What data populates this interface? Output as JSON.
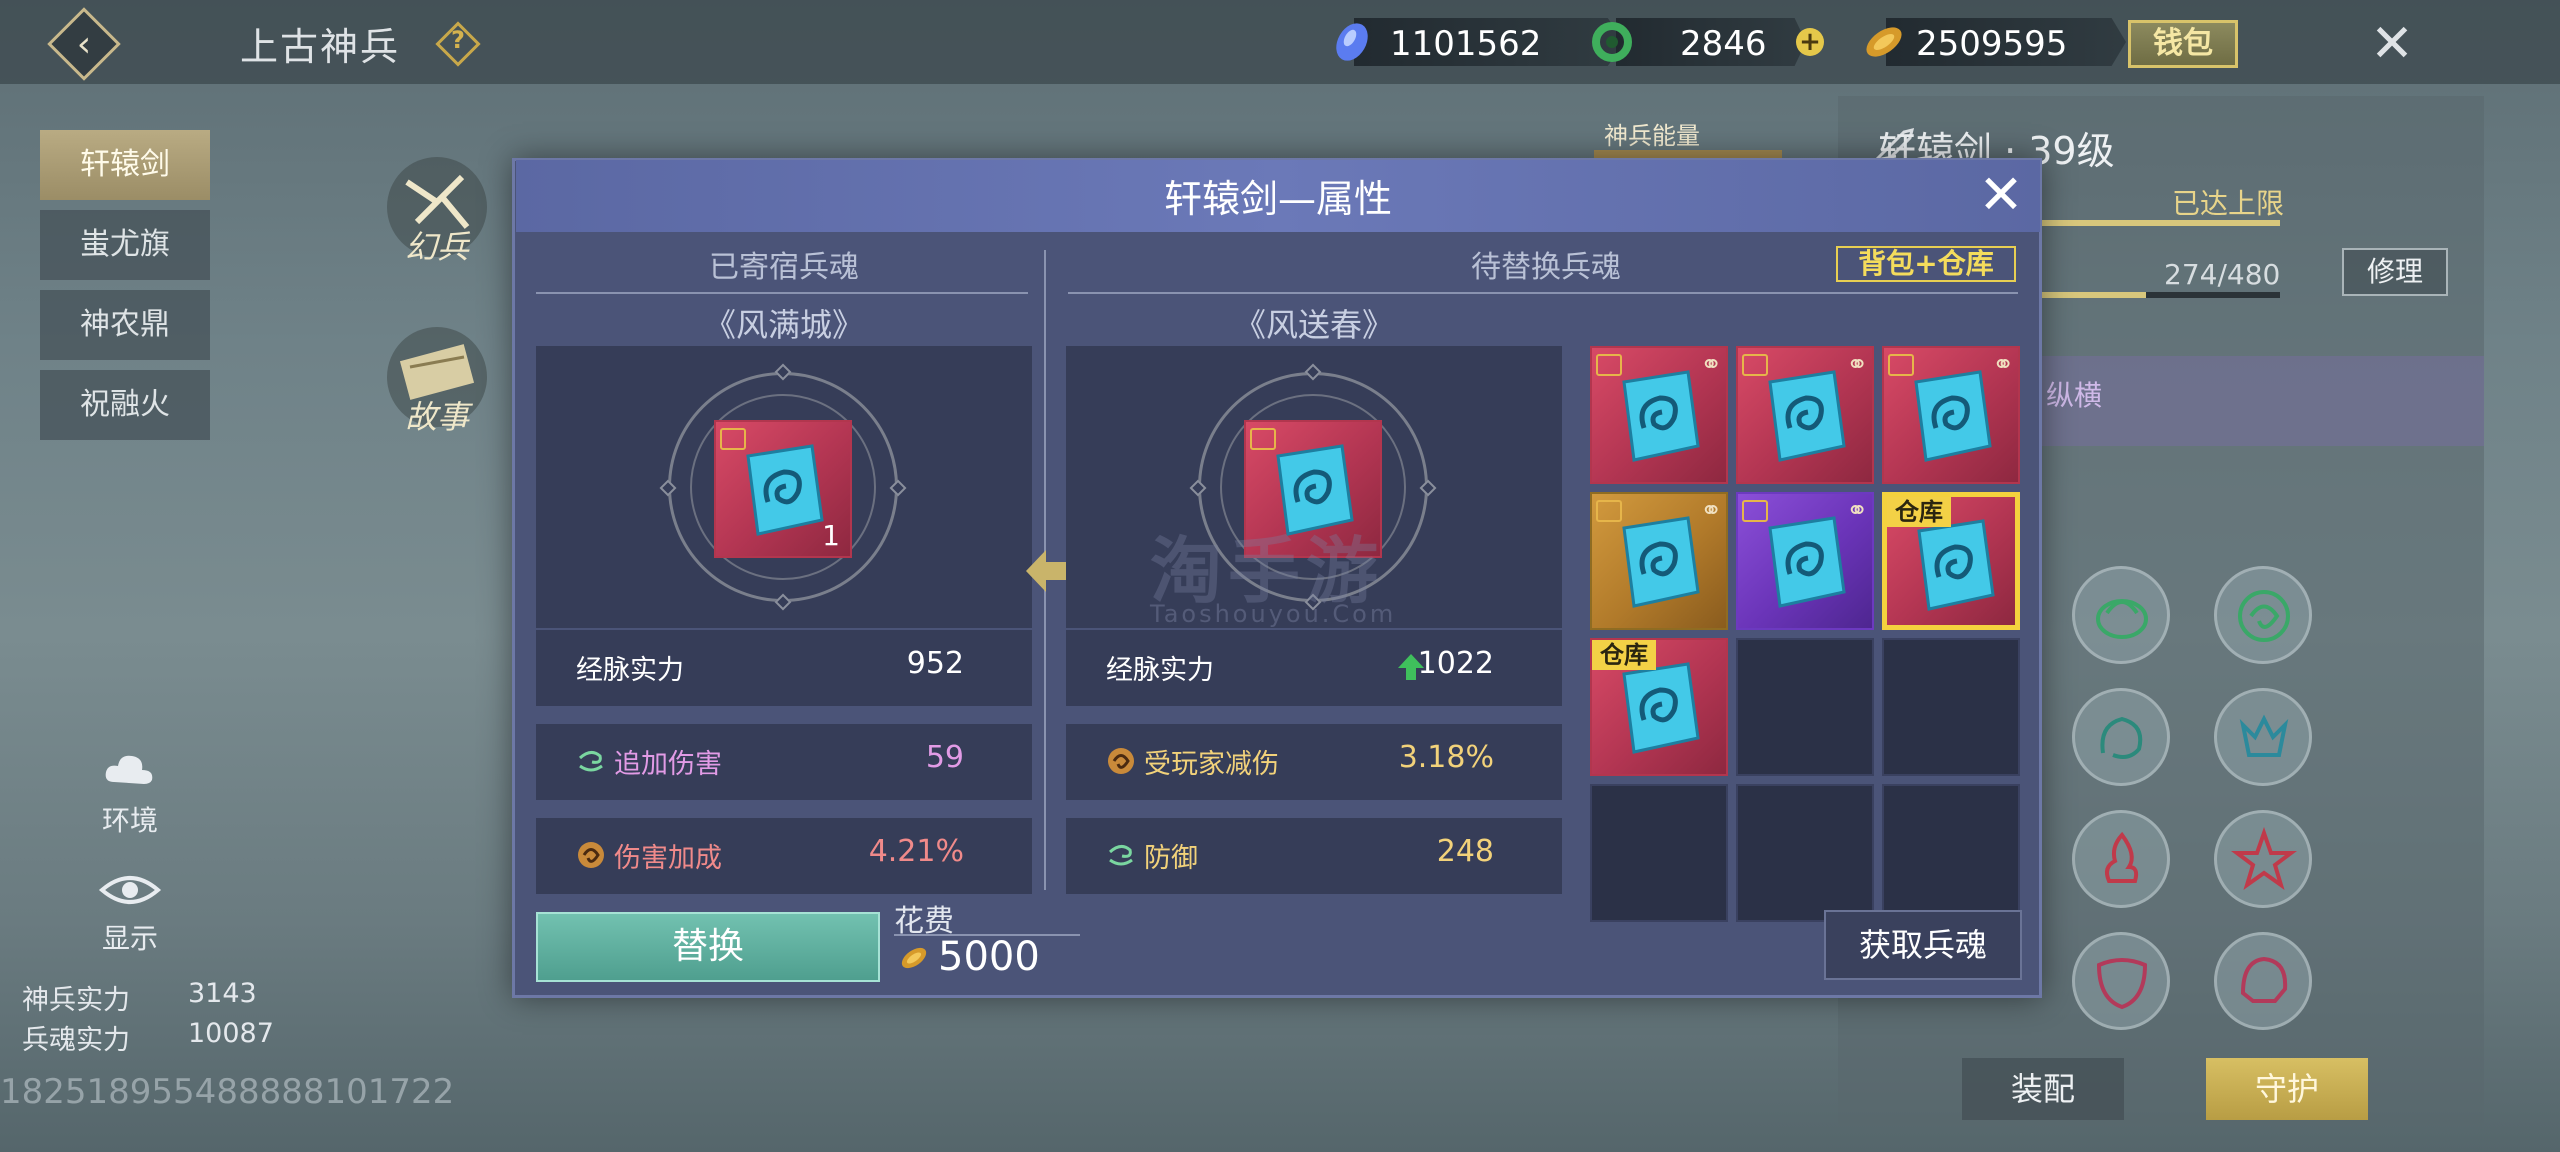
{
  "header": {
    "title": "上古神兵",
    "help": "?",
    "wallet_label": "钱包",
    "currencies": [
      {
        "name": "blue-crystal",
        "value": "1101562"
      },
      {
        "name": "jade-ring",
        "value": "2846"
      },
      {
        "name": "gold-ingot",
        "value": "2509595"
      }
    ],
    "plus": "+",
    "close": "✕",
    "back": "‹"
  },
  "nav": {
    "items": [
      "轩辕剑",
      "蚩尤旗",
      "神农鼎",
      "祝融火"
    ],
    "active_index": 0,
    "emblems": [
      "幻兵",
      "故事"
    ]
  },
  "tools": {
    "environment": "环境",
    "display": "显示"
  },
  "stats": {
    "weapon_power_label": "神兵实力",
    "weapon_power_value": "3143",
    "soul_power_label": "兵魂实力",
    "soul_power_value": "10087"
  },
  "uid": "182518955488888101722",
  "right_panel": {
    "weapon_title": "轩辕剑 · 39级",
    "level_status": "已达上限",
    "durability": "274/480",
    "durability_fraction": 0.57,
    "repair_label": "修理",
    "band_text": "纵横",
    "energy_label": "神兵能量",
    "energy_help": "?",
    "equip_label": "装配",
    "guard_label": "守护"
  },
  "modal": {
    "title": "轩辕剑—属性",
    "close": "✕",
    "left": {
      "section_title": "已寄宿兵魂",
      "soul_name": "《风满城》",
      "item_count": "1",
      "stats": [
        {
          "label": "经脉实力",
          "value": "952",
          "color": "#ffffff"
        },
        {
          "label": "追加伤害",
          "value": "59",
          "color": "#e29be6"
        },
        {
          "label": "伤害加成",
          "value": "4.21%",
          "color": "#f08a8a"
        }
      ]
    },
    "right": {
      "section_title": "待替换兵魂",
      "bag_button": "背包+仓库",
      "soul_name": "《风送春》",
      "stats": [
        {
          "label": "经脉实力",
          "value": "1022",
          "color": "#ffffff"
        },
        {
          "label": "受玩家减伤",
          "value": "3.18%",
          "color": "#f2d27a"
        },
        {
          "label": "防御",
          "value": "248",
          "color": "#f2d27a"
        }
      ]
    },
    "inventory": [
      {
        "rarity": "red",
        "linked": true,
        "tag": ""
      },
      {
        "rarity": "red",
        "linked": true,
        "tag": ""
      },
      {
        "rarity": "red",
        "linked": true,
        "tag": ""
      },
      {
        "rarity": "gold",
        "linked": true,
        "tag": ""
      },
      {
        "rarity": "purple",
        "linked": true,
        "tag": ""
      },
      {
        "rarity": "red",
        "linked": false,
        "tag": "仓库",
        "selected": true
      },
      {
        "rarity": "red",
        "linked": false,
        "tag": "仓库"
      },
      {
        "rarity": "empty"
      },
      {
        "rarity": "empty"
      },
      {
        "rarity": "empty"
      },
      {
        "rarity": "empty"
      },
      {
        "rarity": "empty"
      }
    ],
    "replace_label": "替换",
    "cost_label": "花费",
    "cost_value": "5000",
    "fetch_label": "获取兵魂",
    "watermark": "淘手游",
    "watermark_url": "Taoshouyou.Com"
  },
  "colors": {
    "accent_gold": "#d8c36a",
    "modal_bg": "#4b5478",
    "replace_green": "#5fb0a0"
  }
}
